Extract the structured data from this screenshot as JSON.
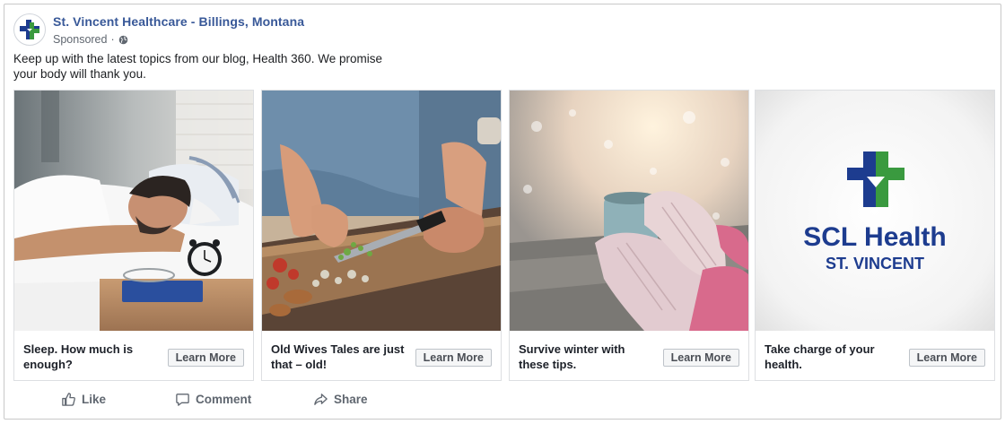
{
  "post": {
    "page_name": "St. Vincent Healthcare - Billings, Montana",
    "sponsored_label": "Sponsored",
    "separator": "·",
    "body_text": "Keep up with the latest topics from our blog, Health 360. We promise your body will thank you."
  },
  "cards": [
    {
      "title": "Sleep. How much is enough?",
      "button": "Learn More",
      "image": "man-sleeping-photo"
    },
    {
      "title": "Old Wives Tales are just that – old!",
      "button": "Learn More",
      "image": "chopping-vegetables-photo"
    },
    {
      "title": "Survive winter with these tips.",
      "button": "Learn More",
      "image": "hands-holding-mug-photo"
    },
    {
      "title": "Take charge of your health.",
      "button": "Learn More",
      "image": "scl-health-logo"
    }
  ],
  "logo": {
    "line1": "SCL Health",
    "line2": "ST. VINCENT",
    "blue": "#1d3c8f",
    "green": "#3a9a3f"
  },
  "actions": {
    "like": "Like",
    "comment": "Comment",
    "share": "Share"
  },
  "colors": {
    "page_name": "#385898",
    "meta": "#606770",
    "border": "#c8c8c8"
  }
}
